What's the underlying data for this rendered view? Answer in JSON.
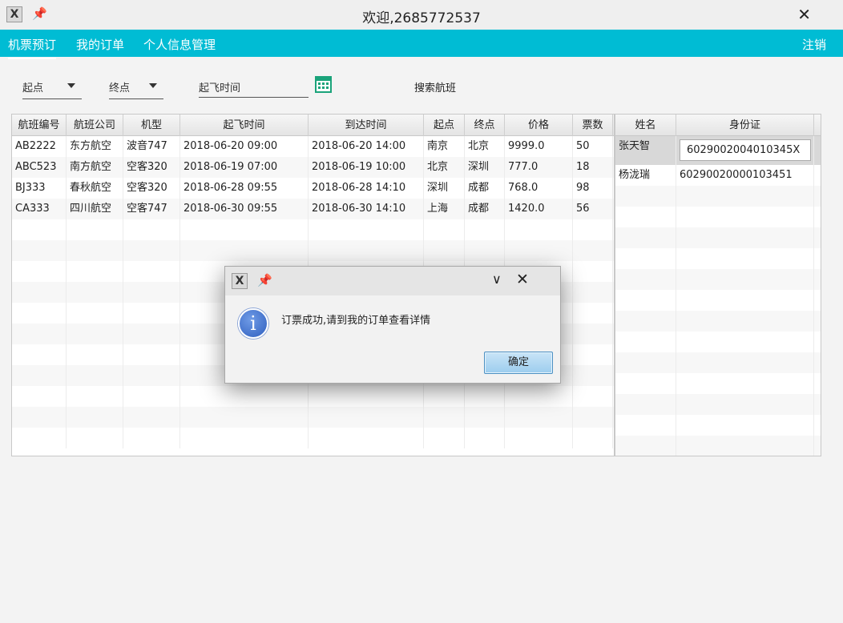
{
  "window": {
    "title": "欢迎,2685772537",
    "close_glyph": "✕"
  },
  "menu": {
    "items": [
      {
        "label": "机票预订",
        "active": true
      },
      {
        "label": "我的订单",
        "active": false
      },
      {
        "label": "个人信息管理",
        "active": false
      }
    ],
    "logout": "注销"
  },
  "search": {
    "origin": "起点",
    "destination": "终点",
    "depart_time": "起飞时间",
    "search_label": "搜索航班"
  },
  "flights": {
    "columns": [
      "航班编号",
      "航班公司",
      "机型",
      "起飞时间",
      "到达时间",
      "起点",
      "终点",
      "价格",
      "票数"
    ],
    "rows": [
      [
        "AB2222",
        "东方航空",
        "波音747",
        "2018-06-20 09:00",
        "2018-06-20 14:00",
        "南京",
        "北京",
        "9999.0",
        "50"
      ],
      [
        "ABC523",
        "南方航空",
        "空客320",
        "2018-06-19 07:00",
        "2018-06-19 10:00",
        "北京",
        "深圳",
        "777.0",
        "18"
      ],
      [
        "BJ333",
        "春秋航空",
        "空客320",
        "2018-06-28 09:55",
        "2018-06-28 14:10",
        "深圳",
        "成都",
        "768.0",
        "98"
      ],
      [
        "CA333",
        "四川航空",
        "空客747",
        "2018-06-30 09:55",
        "2018-06-30 14:10",
        "上海",
        "成都",
        "1420.0",
        "56"
      ]
    ]
  },
  "passengers": {
    "columns": [
      "姓名",
      "身份证"
    ],
    "rows": [
      [
        "张天智",
        "6029002004010345X"
      ],
      [
        "杨泷瑞",
        "60290020000103451"
      ]
    ]
  },
  "dialog": {
    "message": "订票成功,请到我的订单查看详情",
    "ok_label": "确定",
    "minimize_glyph": "∨",
    "close_glyph": "✕"
  }
}
